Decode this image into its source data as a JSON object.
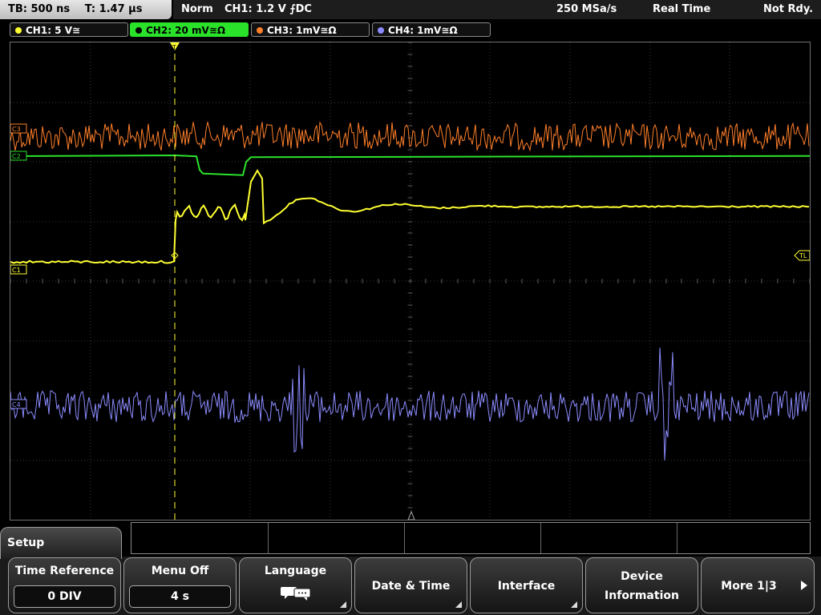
{
  "header": {
    "timebase": "TB: 500 ns",
    "trigger_time": "T: 1.47 µs",
    "mode": "Norm",
    "trigger": "CH1: 1.2 V ⨍DC",
    "sample_rate": "250 MSa/s",
    "acq_mode": "Real Time",
    "status": "Not Rdy."
  },
  "channels": [
    {
      "label": "CH1: 5 V≅",
      "color": "#ffff33"
    },
    {
      "label": "CH2: 20 mV≅Ω",
      "color": "#2be22b"
    },
    {
      "label": "CH3: 1mV≅Ω",
      "color": "#ff7f2a"
    },
    {
      "label": "CH4: 1mV≅Ω",
      "color": "#8b8bff"
    }
  ],
  "markers": {
    "c1": "C1",
    "c2": "C2",
    "c3": "C3",
    "c4": "C4",
    "trigger_level": "TL",
    "trigger_pos": "T"
  },
  "menu": {
    "title": "Setup",
    "softkeys": [
      {
        "label": "Time Reference",
        "value": "0 DIV"
      },
      {
        "label": "Menu Off",
        "value": "4 s"
      },
      {
        "label": "Language",
        "icon": "speech-bubble-icon"
      },
      {
        "label": "Date & Time"
      },
      {
        "label": "Interface"
      },
      {
        "label": "Device Information",
        "line1": "Device",
        "line2": "Information"
      },
      {
        "label": "More 1|3"
      }
    ]
  }
}
